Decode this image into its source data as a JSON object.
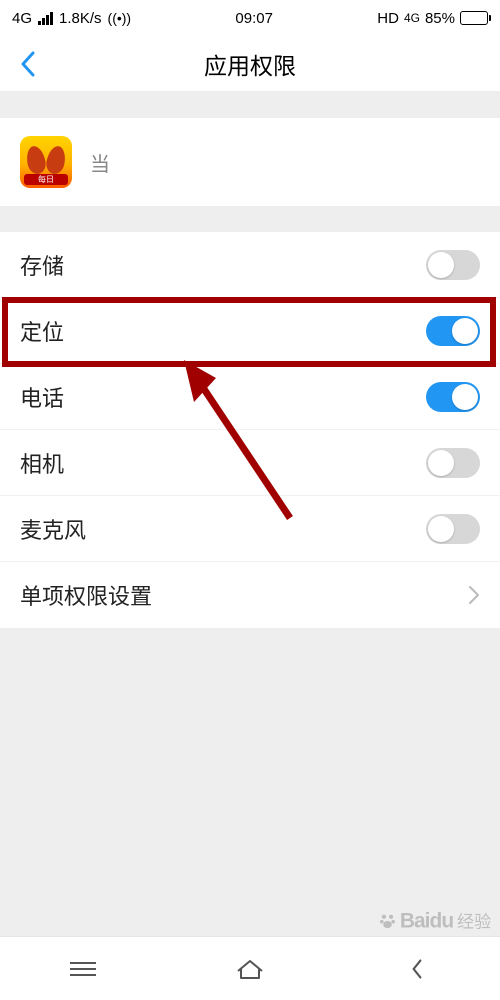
{
  "statusbar": {
    "network": "4G",
    "speed": "1.8K/s",
    "time": "09:07",
    "hd": "HD",
    "net_gen": "4G",
    "battery_pct": "85%"
  },
  "nav": {
    "title": "应用权限"
  },
  "app": {
    "name": "当",
    "icon_tag": "每日"
  },
  "permissions": {
    "storage": {
      "label": "存储",
      "on": false
    },
    "location": {
      "label": "定位",
      "on": true
    },
    "phone": {
      "label": "电话",
      "on": true
    },
    "camera": {
      "label": "相机",
      "on": false
    },
    "mic": {
      "label": "麦克风",
      "on": false
    },
    "single": {
      "label": "单项权限设置"
    }
  },
  "watermark": {
    "brand": "Baidu",
    "cn": "经验"
  }
}
